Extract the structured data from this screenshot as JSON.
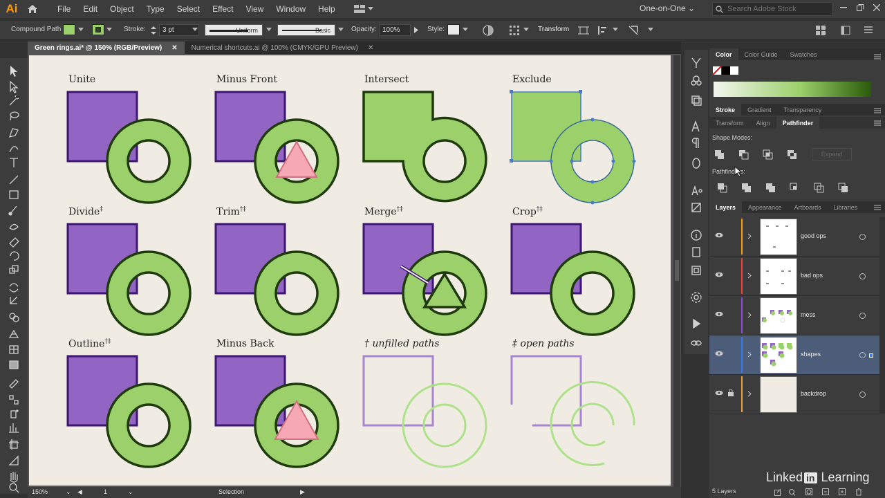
{
  "app": {
    "logo": "Ai",
    "workspace": "One-on-One",
    "search_placeholder": "Search Adobe Stock"
  },
  "menu": [
    "File",
    "Edit",
    "Object",
    "Type",
    "Select",
    "Effect",
    "View",
    "Window",
    "Help"
  ],
  "control": {
    "object_type": "Compound Path",
    "fill_color": "#9bd06a",
    "stroke_label": "Stroke:",
    "stroke_weight": "3 pt",
    "profile": "Uniform",
    "brush": "Basic",
    "opacity_label": "Opacity:",
    "opacity": "100%",
    "style_label": "Style:",
    "transform": "Transform"
  },
  "tabs": [
    {
      "label": "Green rings.ai* @ 150% (RGB/Preview)",
      "active": true
    },
    {
      "label": "Numerical shortcuts.ai @ 100% (CMYK/GPU Preview)",
      "active": false
    }
  ],
  "artboard": {
    "colors": {
      "purple": "#9264c4",
      "purple_stroke": "#3c1670",
      "green": "#9bd06a",
      "green_stroke": "#1f3b0c",
      "pink": "#f6a8b4",
      "line_purple": "#a885d0",
      "line_green": "#aee28a"
    },
    "labels": {
      "unite": "Unite",
      "minus_front": "Minus Front",
      "intersect": "Intersect",
      "exclude": "Exclude",
      "divide": "Divide",
      "trim": "Trim",
      "merge": "Merge",
      "crop": "Crop",
      "outline": "Outline",
      "minus_back": "Minus Back",
      "unfilled": "unfilled paths",
      "open": "open paths",
      "dagger": "†",
      "ddagger": "‡",
      "both": "†‡"
    }
  },
  "status": {
    "zoom": "150%",
    "artboard": "1",
    "tool": "Selection"
  },
  "panels": {
    "color_tabs": [
      "Color",
      "Color Guide",
      "Swatches"
    ],
    "stroke_tabs": [
      "Stroke",
      "Gradient",
      "Transparency"
    ],
    "transform_tabs": [
      "Transform",
      "Align",
      "Pathfinder"
    ],
    "shape_modes_label": "Shape Modes:",
    "pathfinders_label": "Pathfinders:",
    "expand_label": "Expand",
    "layers_tabs": [
      "Layers",
      "Appearance",
      "Artboards",
      "Libraries"
    ],
    "layers": [
      {
        "name": "good ops",
        "color": "#f0a01e"
      },
      {
        "name": "bad ops",
        "color": "#e8453c"
      },
      {
        "name": "mess",
        "color": "#8a4fd0"
      },
      {
        "name": "shapes",
        "color": "#3c7ae8",
        "selected": true
      },
      {
        "name": "backdrop",
        "color": "#e8a04c"
      }
    ],
    "layers_count": "5 Layers"
  },
  "watermark": {
    "linked": "Linked",
    "in": "in",
    "learning": "Learning"
  }
}
